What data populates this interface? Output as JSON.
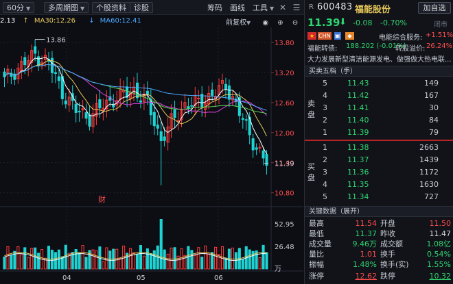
{
  "toolbar": {
    "period": "60分",
    "multi_period": "多周期图",
    "stock_info": "个股资料",
    "diagnose": "诊股",
    "chips": "筹码",
    "draw_line": "画线",
    "tools": "工具"
  },
  "chart": {
    "ma_legend": [
      {
        "label": "2.13",
        "color": "#ffffff"
      },
      {
        "label": "MA30:12.26",
        "color": "#e8c95a"
      },
      {
        "label": "MA60:12.41",
        "color": "#4aa8ff"
      }
    ],
    "adjust_label": "前复权",
    "price_axis": [
      "13.80",
      "13.20",
      "12.60",
      "12.00",
      "11.40",
      "10.80"
    ],
    "high_marker": "13.86",
    "last_marker": "11.39",
    "finance_tag": "财",
    "volume_axis": [
      "52.95",
      "26.48",
      "万"
    ],
    "x_axis": [
      "04",
      "05",
      "06"
    ],
    "colors": {
      "up": "#ff3b3b",
      "down": "#1fd3d3",
      "ma5": "#ffffff",
      "ma10": "#e8c95a",
      "ma20": "#e040e0",
      "ma30": "#5bd35b",
      "ma60": "#4aa8ff"
    }
  },
  "stock": {
    "r_tag": "R",
    "code": "600483",
    "name": "福能股份",
    "watch_button": "加自选",
    "last": "11.39",
    "change": "-0.08",
    "change_pct": "-0.70%",
    "status": "闭市",
    "flags": [
      "",
      "CHN",
      "",
      ""
    ],
    "service_label": "电能综合服务:",
    "service_value": "+1.51%",
    "conv_label": "福能转债:",
    "conv_value": "188.202 (-0.01%)",
    "premium_label": "转股溢价:",
    "premium_value": "26.24%",
    "news": "大力发展新型清洁能源发电、做强做大热电联..."
  },
  "orderbook": {
    "title": "买卖五档（手）",
    "ask_label": [
      "卖",
      "盘"
    ],
    "bid_label": [
      "买",
      "盘"
    ],
    "asks": [
      {
        "level": "5",
        "price": "11.43",
        "volume": "149"
      },
      {
        "level": "4",
        "price": "11.42",
        "volume": "167"
      },
      {
        "level": "3",
        "price": "11.41",
        "volume": "30"
      },
      {
        "level": "2",
        "price": "11.40",
        "volume": "84"
      },
      {
        "level": "1",
        "price": "11.39",
        "volume": "79"
      }
    ],
    "bids": [
      {
        "level": "1",
        "price": "11.38",
        "volume": "2663"
      },
      {
        "level": "2",
        "price": "11.37",
        "volume": "1439"
      },
      {
        "level": "3",
        "price": "11.36",
        "volume": "1172"
      },
      {
        "level": "4",
        "price": "11.35",
        "volume": "1630"
      },
      {
        "level": "5",
        "price": "11.34",
        "volume": "727"
      }
    ]
  },
  "key_data": {
    "title": "关键数据（展开）",
    "rows": [
      {
        "l1": "最高",
        "v1": "11.54",
        "c1": "red",
        "l2": "开盘",
        "v2": "11.50",
        "c2": "red"
      },
      {
        "l1": "最低",
        "v1": "11.37",
        "c1": "green",
        "l2": "昨收",
        "v2": "11.47",
        "c2": "white"
      },
      {
        "l1": "成交量",
        "v1": "9.46万",
        "c1": "green",
        "l2": "成交额",
        "v2": "1.08亿",
        "c2": "green"
      },
      {
        "l1": "量比",
        "v1": "1.01",
        "c1": "red",
        "l2": "换手",
        "v2": "0.54%",
        "c2": "green"
      },
      {
        "l1": "振幅",
        "v1": "1.48%",
        "c1": "green",
        "l2": "换手(实)",
        "v2": "1.55%",
        "c2": "green"
      },
      {
        "l1": "涨停",
        "v1": "12.62",
        "c1": "red",
        "l2": "跌停",
        "v2": "10.32",
        "c2": "green"
      }
    ]
  }
}
